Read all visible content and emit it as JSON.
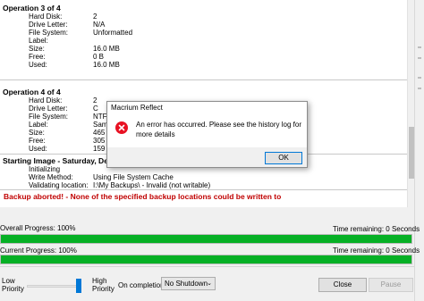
{
  "log": {
    "op3": {
      "title": "Operation 3 of 4",
      "rows": [
        {
          "k": "Hard Disk:",
          "v": "2"
        },
        {
          "k": "Drive Letter:",
          "v": "N/A"
        },
        {
          "k": "File System:",
          "v": "Unformatted"
        },
        {
          "k": "Label:",
          "v": ""
        },
        {
          "k": "Size:",
          "v": "16.0 MB"
        },
        {
          "k": "Free:",
          "v": "0 B"
        },
        {
          "k": "Used:",
          "v": "16.0 MB"
        }
      ]
    },
    "op4": {
      "title": "Operation 4 of 4",
      "rows": [
        {
          "k": "Hard Disk:",
          "v": "2"
        },
        {
          "k": "Drive Letter:",
          "v": "C"
        },
        {
          "k": "File System:",
          "v": "NTF"
        },
        {
          "k": "Label:",
          "v": "Sam"
        },
        {
          "k": "Size:",
          "v": "465"
        },
        {
          "k": "Free:",
          "v": "305"
        },
        {
          "k": "Used:",
          "v": "159"
        }
      ]
    },
    "starting": {
      "title": "Starting Image - Saturday, Decem",
      "rows": [
        {
          "k": "Initializing",
          "v": ""
        },
        {
          "k": "Write Method:",
          "v": "Using File System Cache"
        },
        {
          "k": "Validating location:",
          "v": "I:\\My Backups\\ - Invalid (not writable)"
        }
      ]
    },
    "error_line": "Backup aborted! - None of the specified backup locations could be written to"
  },
  "progress": {
    "overall_label": "Overall Progress:  100%",
    "overall_time": "Time remaining: 0 Seconds",
    "overall_value": 1.0,
    "current_label": "Current Progress:  100%",
    "current_time": "Time remaining: 0 Seconds",
    "current_value": 1.0,
    "fill_color": "#06b025"
  },
  "footer": {
    "low_label_1": "Low",
    "low_label_2": "Priority",
    "high_label_1": "High",
    "high_label_2": "Priority",
    "on_completion_label": "On completion",
    "on_completion_value": "No Shutdown",
    "close_label": "Close",
    "pause_label": "Pause"
  },
  "dialog": {
    "title": "Macrium Reflect",
    "message": "An error has occurred. Please see the history log for more details",
    "ok_label": "OK",
    "icon": "error-icon"
  }
}
